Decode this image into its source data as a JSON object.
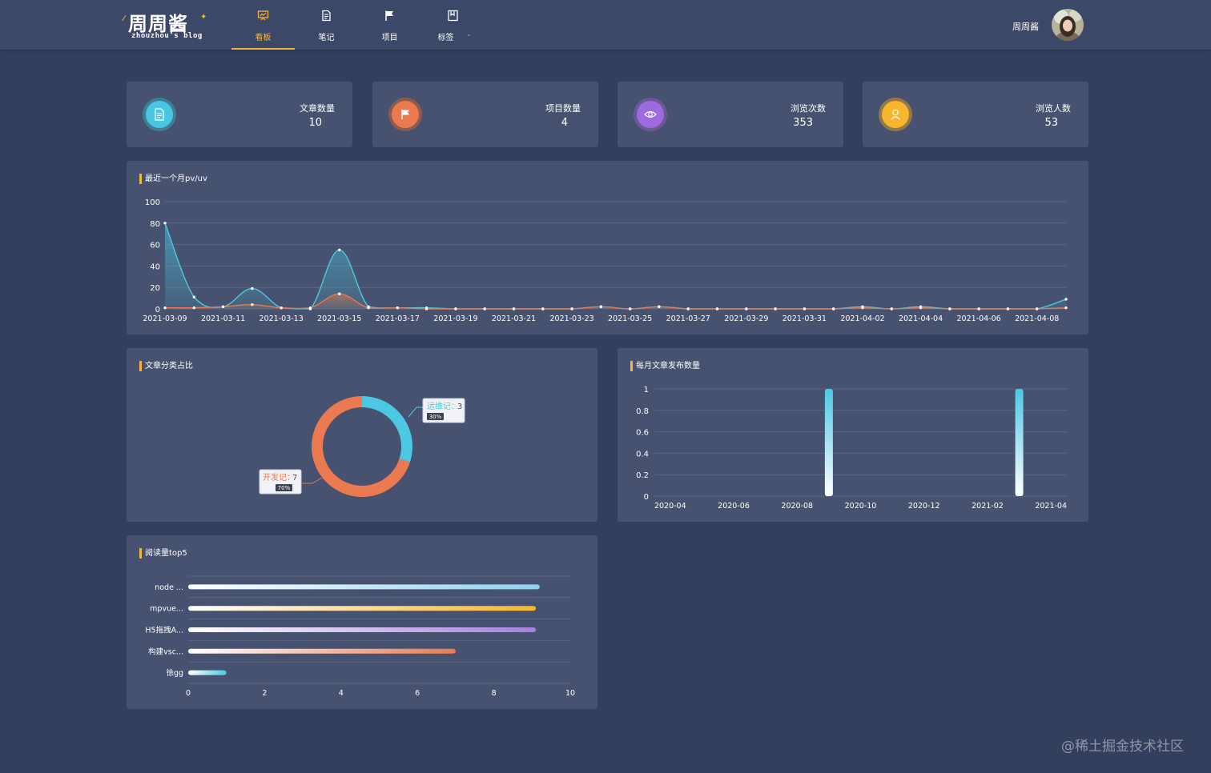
{
  "header": {
    "logo_main": "周周酱",
    "logo_sub": "zhouzhou's blog",
    "nav": [
      {
        "label": "看板",
        "icon": "dashboard-icon",
        "active": true
      },
      {
        "label": "笔记",
        "icon": "document-icon",
        "active": false
      },
      {
        "label": "项目",
        "icon": "flag-icon",
        "active": false
      },
      {
        "label": "标签",
        "icon": "bookmark-icon",
        "active": false
      }
    ],
    "user_name": "周周酱"
  },
  "stats": [
    {
      "label": "文章数量",
      "value": "10",
      "color": "#48c6e2",
      "ring": "#3f7f95",
      "icon": "document-icon"
    },
    {
      "label": "项目数量",
      "value": "4",
      "color": "#eb7a50",
      "ring": "#8d5a4e",
      "icon": "flag-icon"
    },
    {
      "label": "浏览次数",
      "value": "353",
      "color": "#9d6ae0",
      "ring": "#6c5896",
      "icon": "eye-icon"
    },
    {
      "label": "浏览人数",
      "value": "53",
      "color": "#f8b62c",
      "ring": "#93784a",
      "icon": "user-icon"
    }
  ],
  "pvuv": {
    "title": "最近一个月pv/uv",
    "chart_data": {
      "type": "line",
      "x": [
        "2021-03-09",
        "2021-03-10",
        "2021-03-11",
        "2021-03-12",
        "2021-03-13",
        "2021-03-14",
        "2021-03-15",
        "2021-03-16",
        "2021-03-17",
        "2021-03-18",
        "2021-03-19",
        "2021-03-20",
        "2021-03-21",
        "2021-03-22",
        "2021-03-23",
        "2021-03-24",
        "2021-03-25",
        "2021-03-26",
        "2021-03-27",
        "2021-03-28",
        "2021-03-29",
        "2021-03-30",
        "2021-03-31",
        "2021-04-01",
        "2021-04-02",
        "2021-04-03",
        "2021-04-04",
        "2021-04-05",
        "2021-04-06",
        "2021-04-07",
        "2021-04-08",
        "2021-04-09"
      ],
      "x_tick_labels": [
        "2021-03-09",
        "2021-03-11",
        "2021-03-13",
        "2021-03-15",
        "2021-03-17",
        "2021-03-19",
        "2021-03-21",
        "2021-03-23",
        "2021-03-25",
        "2021-03-27",
        "2021-03-29",
        "2021-03-31",
        "2021-04-02",
        "2021-04-04",
        "2021-04-06",
        "2021-04-08"
      ],
      "series": [
        {
          "color": "#4dc8e3",
          "values": [
            80,
            11,
            2,
            19,
            1,
            0,
            55,
            2,
            1,
            1,
            0,
            0,
            0,
            0,
            0,
            2,
            0,
            2,
            0,
            0,
            0,
            0,
            0,
            0,
            2,
            0,
            2,
            0,
            0,
            0,
            0,
            9
          ]
        },
        {
          "color": "#e8784d",
          "values": [
            1,
            1,
            2,
            4,
            1,
            1,
            14,
            1,
            1,
            0,
            0,
            0,
            0,
            0,
            0,
            2,
            0,
            2,
            0,
            0,
            0,
            0,
            0,
            0,
            1,
            0,
            1,
            0,
            0,
            0,
            0,
            1
          ]
        }
      ],
      "ylim": [
        0,
        100
      ],
      "y_ticks": [
        "0",
        "20",
        "40",
        "60",
        "80",
        "100"
      ]
    }
  },
  "category": {
    "title": "文章分类占比",
    "chart_data": {
      "type": "pie",
      "slices": [
        {
          "name": "运维记",
          "value": 3,
          "percent": "30%",
          "color": "#4dc8e3"
        },
        {
          "name": "开发记",
          "value": 7,
          "percent": "70%",
          "color": "#eb7a50"
        }
      ]
    }
  },
  "monthly": {
    "title": "每月文章发布数量",
    "chart_data": {
      "type": "bar",
      "categories": [
        "2020-04",
        "2020-05",
        "2020-06",
        "2020-07",
        "2020-08",
        "2020-09",
        "2020-10",
        "2020-11",
        "2020-12",
        "2021-01",
        "2021-02",
        "2021-03",
        "2021-04"
      ],
      "x_tick_labels": [
        "2020-04",
        "2020-06",
        "2020-08",
        "2020-10",
        "2020-12",
        "2021-02",
        "2021-04"
      ],
      "values": [
        0,
        0,
        0,
        0,
        0,
        1,
        0,
        0,
        0,
        0,
        0,
        1,
        0
      ],
      "ylim": [
        0,
        1
      ],
      "y_ticks": [
        "0",
        "0.2",
        "0.4",
        "0.6",
        "0.8",
        "1"
      ]
    }
  },
  "top5": {
    "title": "阅读量top5",
    "chart_data": {
      "type": "bar",
      "orientation": "horizontal",
      "categories": [
        "node ...",
        "mpvue...",
        "H5拖拽A...",
        "构建vsc...",
        "徐gg"
      ],
      "values": [
        9.2,
        9.1,
        9.1,
        7,
        1
      ],
      "colors": [
        "#8ed3ee",
        "#f8b62c",
        "#a580de",
        "#eb7a50",
        "#4dc8e3"
      ],
      "xlim": [
        0,
        10
      ],
      "x_ticks": [
        "0",
        "2",
        "4",
        "6",
        "8",
        "10"
      ]
    }
  },
  "watermark": "@稀土掘金技术社区"
}
